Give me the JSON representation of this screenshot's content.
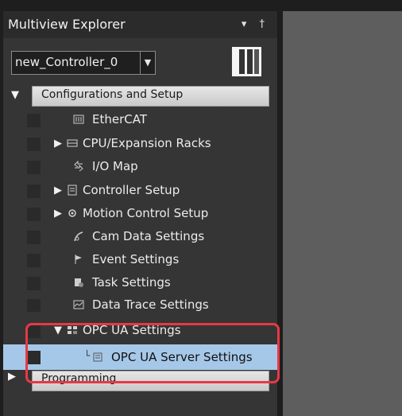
{
  "panel": {
    "title": "Multiview Explorer",
    "pin_glyph": "▾ †"
  },
  "controller": {
    "name": "new_Controller_0",
    "dropdown_icon": "chevron-down-icon"
  },
  "tree": {
    "sections": {
      "config": "Configurations and Setup",
      "programming": "Programming"
    },
    "items": [
      {
        "label": "EtherCAT",
        "icon": "ethercat-icon"
      },
      {
        "label": "CPU/Expansion Racks",
        "icon": "rack-icon"
      },
      {
        "label": "I/O Map",
        "icon": "io-map-icon"
      },
      {
        "label": "Controller Setup",
        "icon": "controller-setup-icon"
      },
      {
        "label": "Motion Control Setup",
        "icon": "gear-icon"
      },
      {
        "label": "Cam Data Settings",
        "icon": "cam-icon"
      },
      {
        "label": "Event Settings",
        "icon": "flag-icon"
      },
      {
        "label": "Task Settings",
        "icon": "task-icon"
      },
      {
        "label": "Data Trace Settings",
        "icon": "trace-icon"
      },
      {
        "label": "OPC UA Settings",
        "icon": "opc-ua-icon"
      },
      {
        "label": "OPC UA Server Settings",
        "icon": "server-settings-icon"
      }
    ]
  },
  "colors": {
    "highlight": "#e63946",
    "selected": "#a6c8e8"
  }
}
